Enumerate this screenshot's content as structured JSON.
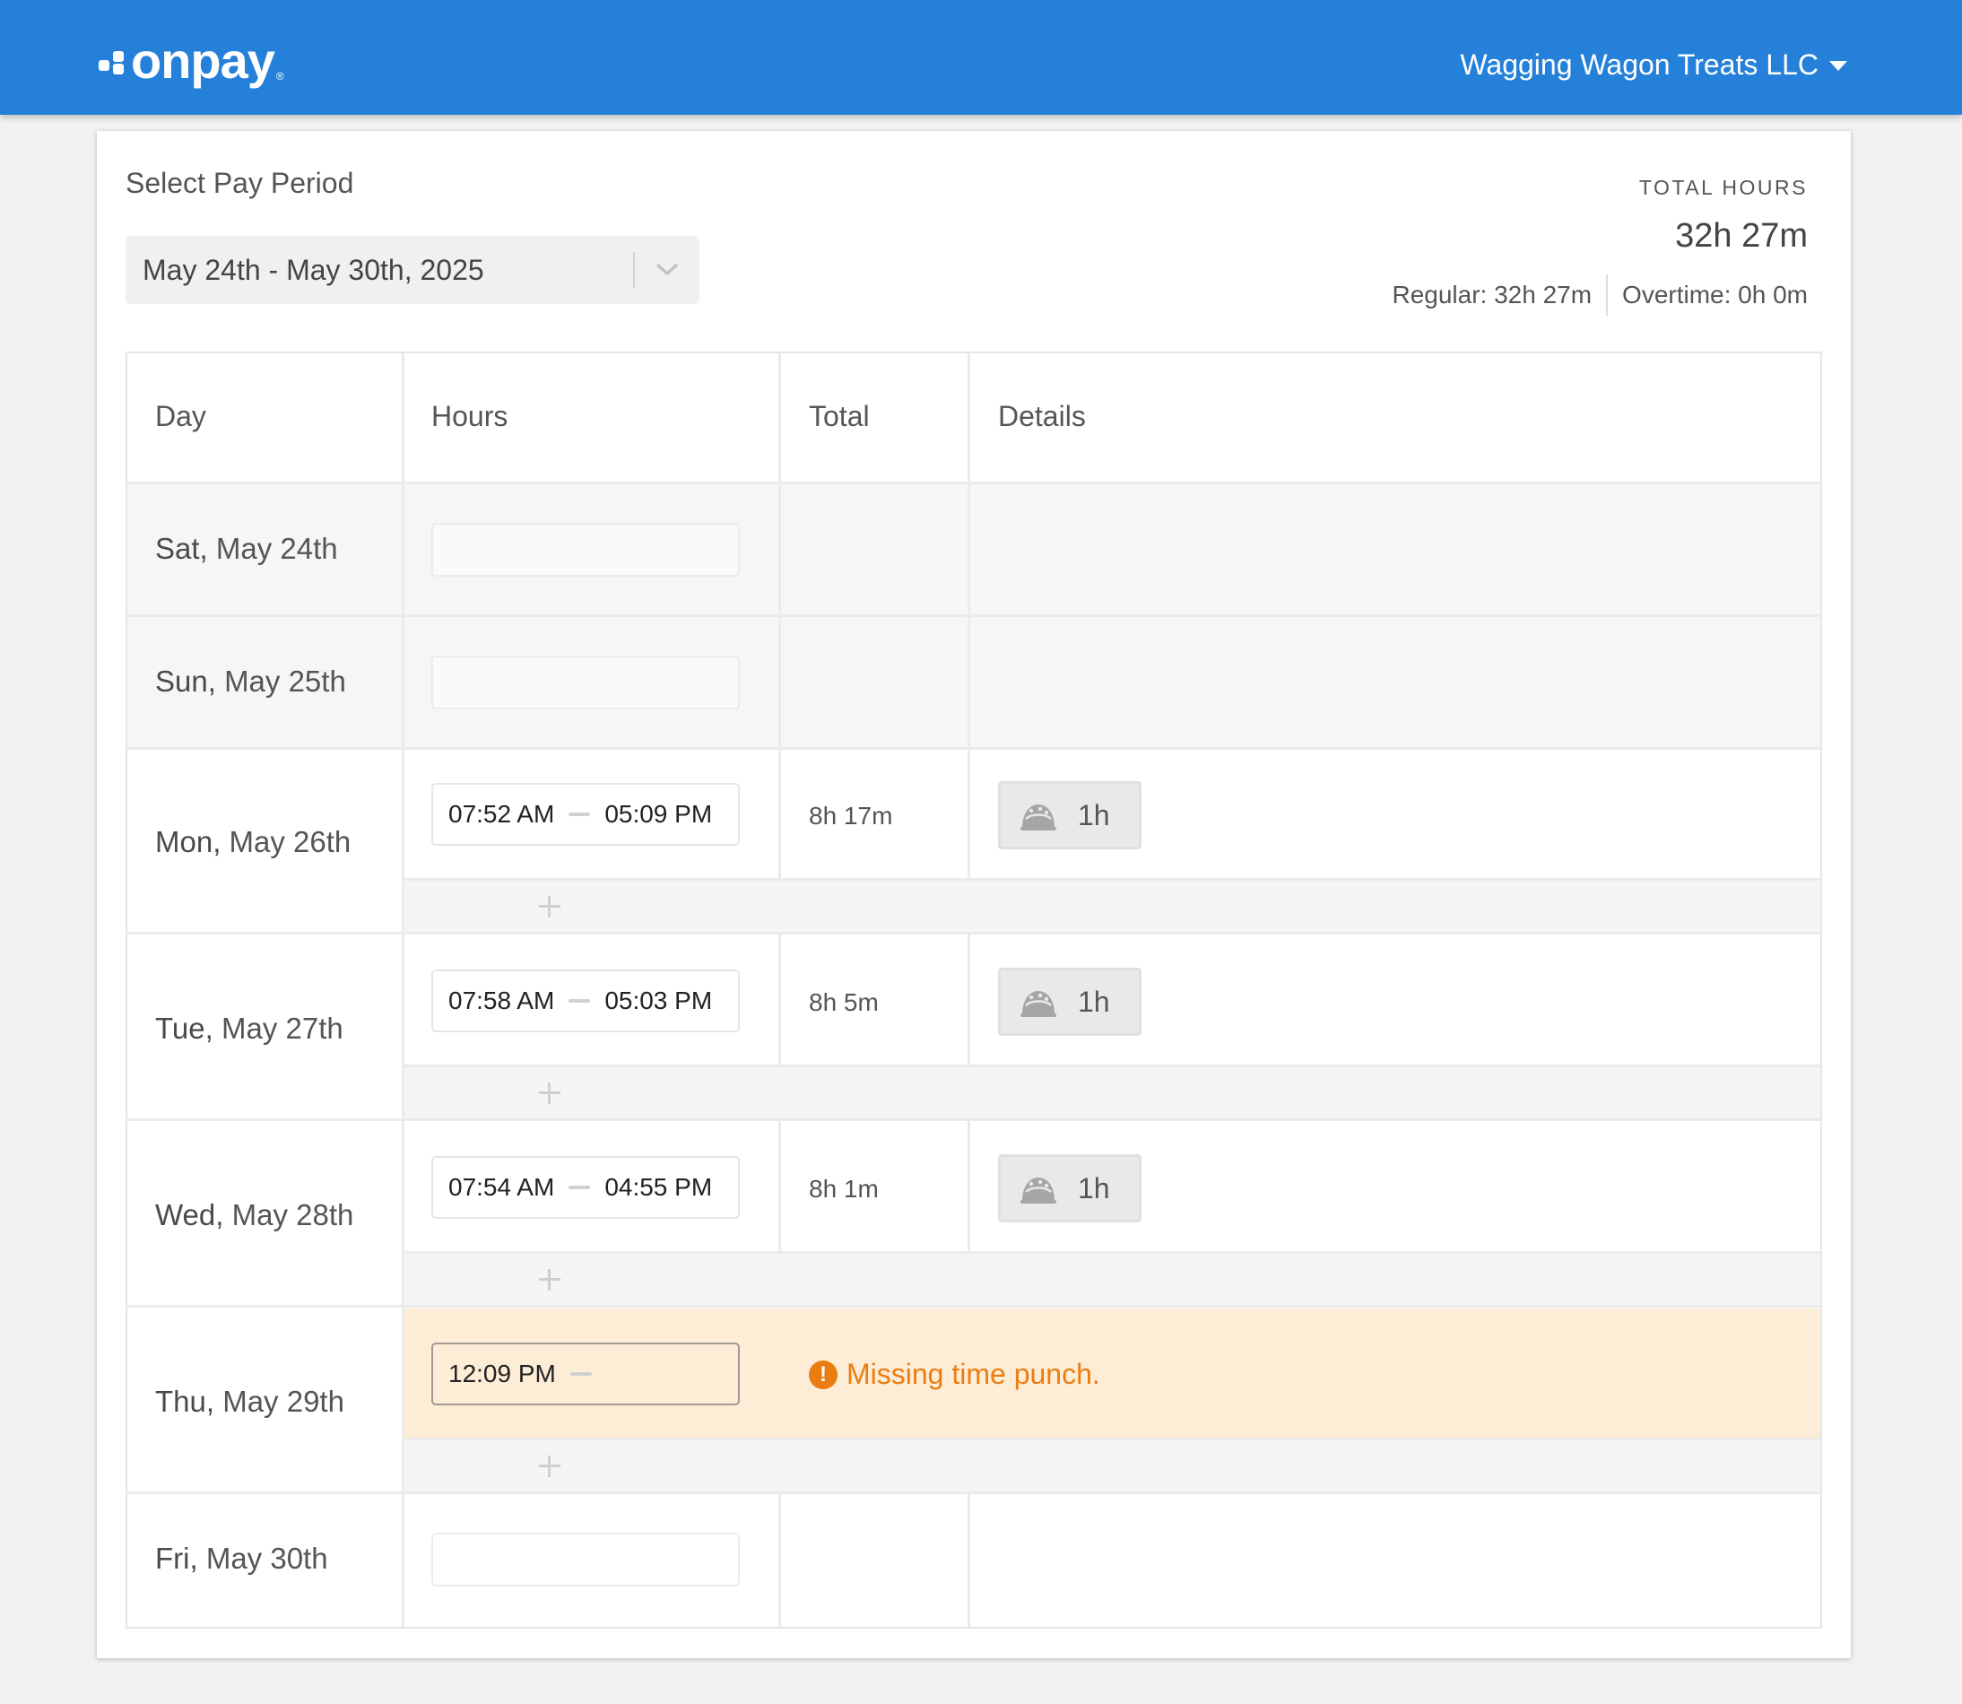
{
  "header": {
    "logo_text": "onpay",
    "logo_registered": "®",
    "company_name": "Wagging Wagon Treats LLC",
    "icon": "caret-down-icon",
    "background_color": "#2580d9"
  },
  "pay_period": {
    "label": "Select Pay Period",
    "selected": "May 24th - May 30th, 2025",
    "icon": "chevron-down-icon"
  },
  "totals": {
    "title": "TOTAL HOURS",
    "value": "32h 27m",
    "regular": "Regular: 32h 27m",
    "overtime": "Overtime: 0h 0m"
  },
  "table": {
    "columns": [
      "Day",
      "Hours",
      "Total",
      "Details"
    ],
    "rows": [
      {
        "dow": "Sat,",
        "date": "May 24th",
        "start": "",
        "end": "",
        "total": "",
        "break": ""
      },
      {
        "dow": "Sun,",
        "date": "May 25th",
        "start": "",
        "end": "",
        "total": "",
        "break": ""
      },
      {
        "dow": "Mon,",
        "date": "May 26th",
        "start": "07:52 AM",
        "end": "05:09 PM",
        "total": "8h 17m",
        "break": "1h",
        "break_icon": "meal-break-icon"
      },
      {
        "dow": "Tue,",
        "date": "May 27th",
        "start": "07:58 AM",
        "end": "05:03 PM",
        "total": "8h 5m",
        "break": "1h",
        "break_icon": "meal-break-icon"
      },
      {
        "dow": "Wed,",
        "date": "May 28th",
        "start": "07:54 AM",
        "end": "04:55 PM",
        "total": "8h 1m",
        "break": "1h",
        "break_icon": "meal-break-icon"
      },
      {
        "dow": "Thu,",
        "date": "May 29th",
        "start": "12:09 PM",
        "end": "",
        "total": "",
        "break": "",
        "warning": "Missing time punch.",
        "warning_icon": "exclamation-circle-icon"
      },
      {
        "dow": "Fri,",
        "date": "May 30th",
        "start": "",
        "end": "",
        "total": "",
        "break": ""
      }
    ],
    "add_icon": "plus-icon"
  },
  "colors": {
    "accent": "#2580d9",
    "warning": "#ea7d12",
    "warning_bg": "#fdecd6",
    "weekend_bg": "#f6f6f6"
  }
}
